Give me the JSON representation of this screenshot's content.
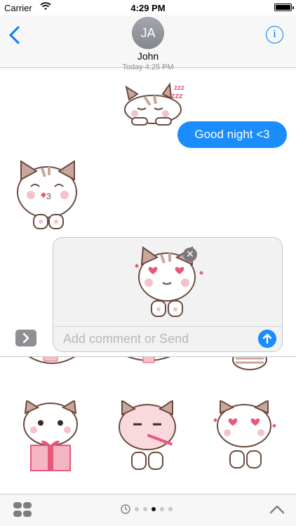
{
  "status_bar": {
    "carrier": "Carrier",
    "time": "4:29 PM"
  },
  "nav": {
    "avatar_initials": "JA",
    "contact_name": "John"
  },
  "conversation": {
    "timestamp": "Today 4:25 PM",
    "outgoing_message": "Good night <3"
  },
  "preview": {
    "comment_placeholder": "Add comment or Send"
  },
  "colors": {
    "accent": "#007aff",
    "bubble": "#1a8cfb",
    "sticker_pink": "#e8587a"
  },
  "icons": [
    "wifi-icon",
    "battery-icon",
    "back-chevron-icon",
    "info-icon",
    "close-icon",
    "send-arrow-icon",
    "expand-chevron-icon",
    "app-drawer-icon",
    "recents-clock-icon",
    "collapse-chevron-icon"
  ],
  "pager": {
    "page_count": 5,
    "active_index": 3
  }
}
